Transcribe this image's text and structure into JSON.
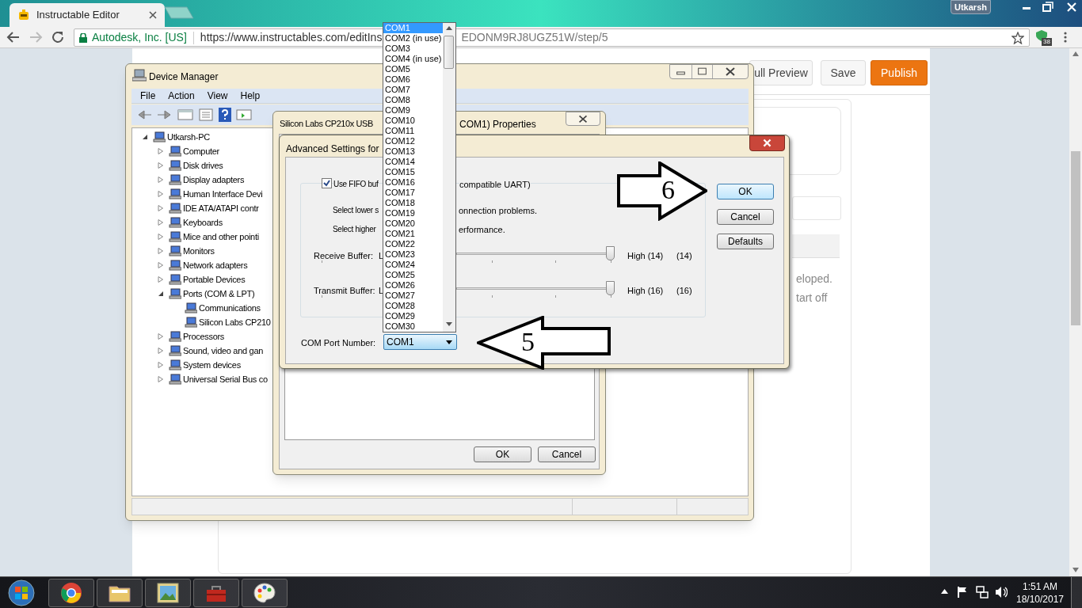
{
  "browser": {
    "tab": {
      "title": "Instructable Editor",
      "selected": true
    },
    "user": "Utkarsh",
    "site_identity": "Autodesk, Inc. [US]",
    "url_start": "https://www.instructables.com/editIns",
    "url_end": "EDONM9RJ8UGZ51W/step/5",
    "extension_badge": "38"
  },
  "page": {
    "buttons": [
      {
        "label": "ull Preview",
        "kind": "plain"
      },
      {
        "label": "Save",
        "kind": "plain"
      },
      {
        "label": "Publish",
        "kind": "primary"
      }
    ],
    "text_fragments": [
      "eloped.",
      "tart off"
    ]
  },
  "device_manager": {
    "title": "Device Manager",
    "menu": [
      "File",
      "Action",
      "View",
      "Help"
    ],
    "tree": [
      {
        "label": "Utkarsh-PC",
        "expanded": true,
        "children": [
          {
            "label": "Computer",
            "expanded": false
          },
          {
            "label": "Disk drives",
            "expanded": false
          },
          {
            "label": "Display adapters",
            "expanded": false
          },
          {
            "label": "Human Interface Devi",
            "expanded": false
          },
          {
            "label": "IDE ATA/ATAPI contr",
            "expanded": false
          },
          {
            "label": "Keyboards",
            "expanded": false
          },
          {
            "label": "Mice and other pointi",
            "expanded": false
          },
          {
            "label": "Monitors",
            "expanded": false
          },
          {
            "label": "Network adapters",
            "expanded": false
          },
          {
            "label": "Portable Devices",
            "expanded": false
          },
          {
            "label": "Ports (COM & LPT)",
            "expanded": true,
            "children": [
              {
                "label": "Communications"
              },
              {
                "label": "Silicon Labs CP210"
              }
            ]
          },
          {
            "label": "Processors",
            "expanded": false
          },
          {
            "label": "Sound, video and gan",
            "expanded": false
          },
          {
            "label": "System devices",
            "expanded": false
          },
          {
            "label": "Universal Serial Bus co",
            "expanded": false
          }
        ]
      }
    ]
  },
  "properties_dialog": {
    "title_start": "Silicon Labs CP210x USB",
    "title_end": "COM1) Properties",
    "buttons": [
      "OK",
      "Cancel"
    ]
  },
  "advanced_dialog": {
    "title": "Advanced Settings for",
    "fifo": {
      "label_start": "Use FIFO buf",
      "label_end": "compatible UART)",
      "checked": true
    },
    "notes": [
      {
        "start": "Select lower s",
        "end": "onnection problems."
      },
      {
        "start": "Select higher",
        "end": "erformance."
      }
    ],
    "sliders": [
      {
        "label": "Receive Buffer:",
        "low": "L",
        "level": 1,
        "high": "High (14)",
        "value": "(14)"
      },
      {
        "label": "Transmit Buffer:",
        "low": "L",
        "level": 1,
        "high": "High (16)",
        "value": "(16)"
      }
    ],
    "com_port": {
      "label": "COM Port Number:",
      "value": "COM1"
    },
    "buttons": [
      {
        "label": "OK",
        "default": true
      },
      {
        "label": "Cancel",
        "default": false
      },
      {
        "label": "Defaults",
        "default": false
      }
    ]
  },
  "com_list": [
    {
      "label": "COM1",
      "selected": true
    },
    {
      "label": "COM2 (in use)",
      "selected": false
    },
    {
      "label": "COM3",
      "selected": false
    },
    {
      "label": "COM4 (in use)",
      "selected": false
    },
    {
      "label": "COM5",
      "selected": false
    },
    {
      "label": "COM6",
      "selected": false
    },
    {
      "label": "COM7",
      "selected": false
    },
    {
      "label": "COM8",
      "selected": false
    },
    {
      "label": "COM9",
      "selected": false
    },
    {
      "label": "COM10",
      "selected": false
    },
    {
      "label": "COM11",
      "selected": false
    },
    {
      "label": "COM12",
      "selected": false
    },
    {
      "label": "COM13",
      "selected": false
    },
    {
      "label": "COM14",
      "selected": false
    },
    {
      "label": "COM15",
      "selected": false
    },
    {
      "label": "COM16",
      "selected": false
    },
    {
      "label": "COM17",
      "selected": false
    },
    {
      "label": "COM18",
      "selected": false
    },
    {
      "label": "COM19",
      "selected": false
    },
    {
      "label": "COM20",
      "selected": false
    },
    {
      "label": "COM21",
      "selected": false
    },
    {
      "label": "COM22",
      "selected": false
    },
    {
      "label": "COM23",
      "selected": false
    },
    {
      "label": "COM24",
      "selected": false
    },
    {
      "label": "COM25",
      "selected": false
    },
    {
      "label": "COM26",
      "selected": false
    },
    {
      "label": "COM27",
      "selected": false
    },
    {
      "label": "COM28",
      "selected": false
    },
    {
      "label": "COM29",
      "selected": false
    },
    {
      "label": "COM30",
      "selected": false
    }
  ],
  "annotations": [
    {
      "number": "6",
      "kind": "rightarrow"
    },
    {
      "number": "5",
      "kind": "leftarrow"
    }
  ],
  "taskbar": {
    "time": "1:51 AM",
    "date": "18/10/2017"
  }
}
